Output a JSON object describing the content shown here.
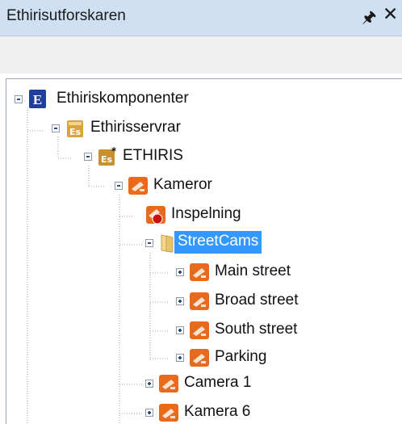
{
  "panel": {
    "title": "Ethirisutforskaren",
    "pin_icon": "pin-icon",
    "close_icon": "close-icon"
  },
  "tree": {
    "root": "Ethiriskomponenter",
    "servers": "Ethirisservrar",
    "server": "ETHIRIS",
    "cameras": "Kameror",
    "recording": "Inspelning",
    "folder": "StreetCams",
    "cam_main": "Main street",
    "cam_broad": "Broad street",
    "cam_south": "South street",
    "cam_parking": "Parking",
    "camera1": "Camera 1",
    "camera6": "Kamera 6"
  },
  "colors": {
    "titlebar": "#cfe0f3",
    "selection": "#3399ff",
    "camera_orange": "#e86a1c",
    "server_gold": "#c89030",
    "root_blue": "#1f3f9a"
  }
}
